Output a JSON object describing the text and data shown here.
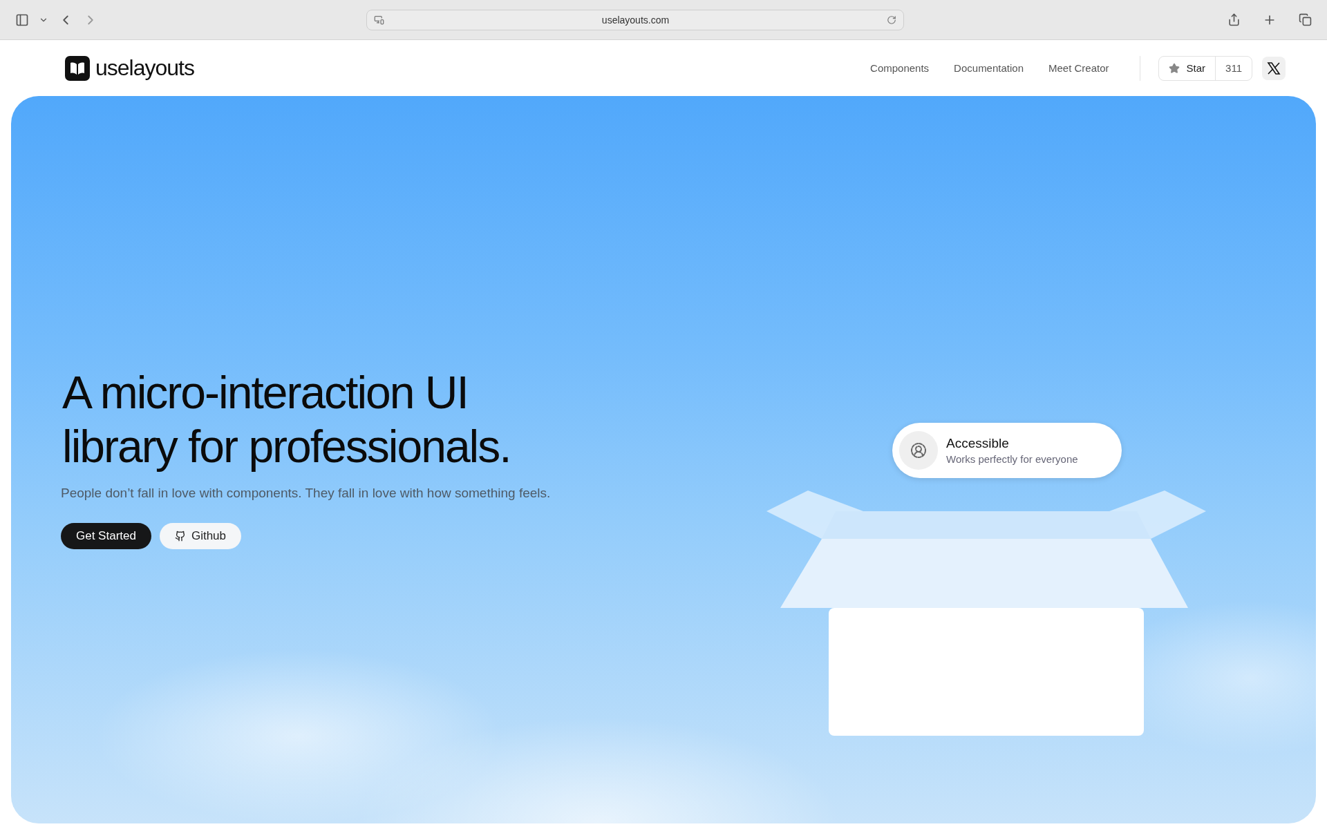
{
  "browser": {
    "url": "uselayouts.com"
  },
  "header": {
    "logo": "uselayouts",
    "nav": [
      "Components",
      "Documentation",
      "Meet Creator"
    ],
    "star": {
      "label": "Star",
      "count": "311"
    }
  },
  "hero": {
    "headline": [
      "A micro-interaction UI",
      "library for professionals."
    ],
    "subtitle": "People don’t fall in love with components. They fall in love with how something feels.",
    "buttons": [
      {
        "label": "Get Started",
        "kind": "primary"
      },
      {
        "label": "Github",
        "kind": "secondary"
      }
    ],
    "feature_card": {
      "title": "Accessible",
      "subtitle": "Works perfectly for everyone"
    }
  }
}
